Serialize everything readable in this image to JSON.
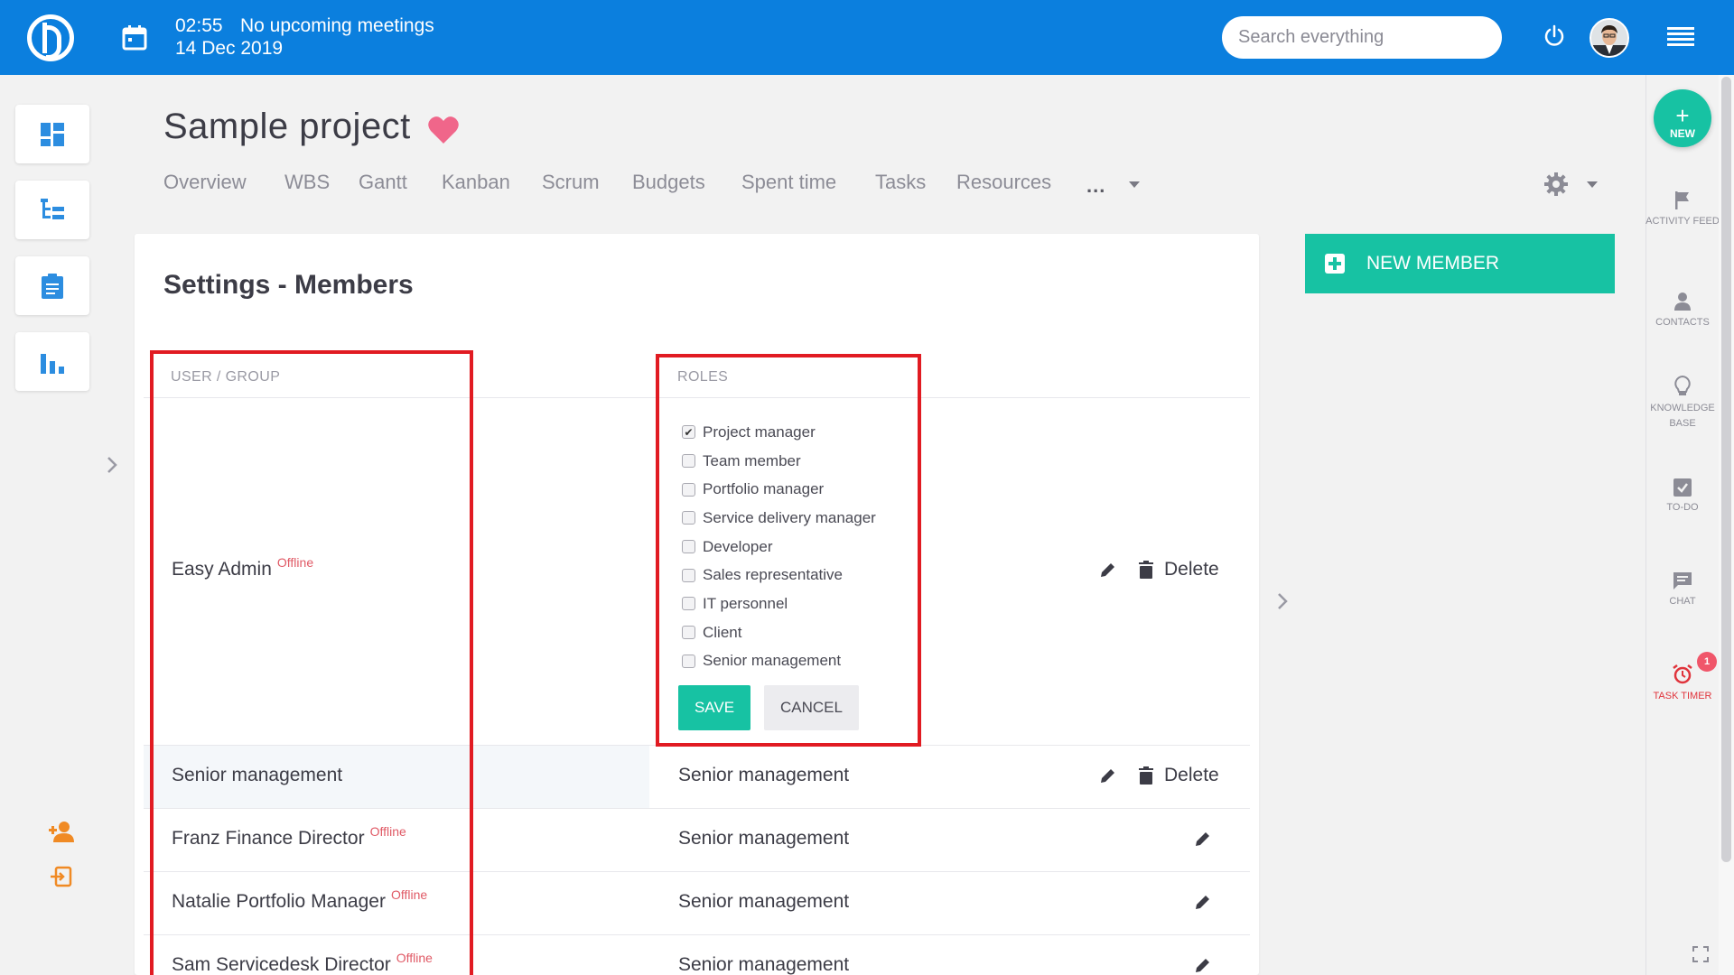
{
  "topbar": {
    "time": "02:55",
    "meetings": "No upcoming meetings",
    "date": "14 Dec 2019",
    "search_placeholder": "Search everything"
  },
  "project": {
    "title": "Sample project",
    "tabs": [
      "Overview",
      "WBS",
      "Gantt",
      "Kanban",
      "Scrum",
      "Budgets",
      "Spent time",
      "Tasks",
      "Resources"
    ],
    "more": "..."
  },
  "card": {
    "title": "Settings - Members",
    "col_user": "USER / GROUP",
    "col_roles": "ROLES"
  },
  "members": [
    {
      "name": "Easy Admin",
      "status": "Offline",
      "roles": "",
      "delete": "Delete"
    },
    {
      "name": "Senior management",
      "status": "",
      "roles": "Senior management",
      "delete": "Delete"
    },
    {
      "name": "Franz Finance Director",
      "status": "Offline",
      "roles": "Senior management",
      "delete": ""
    },
    {
      "name": "Natalie Portfolio Manager",
      "status": "Offline",
      "roles": "Senior management",
      "delete": ""
    },
    {
      "name": "Sam Servicedesk Director",
      "status": "Offline",
      "roles": "Senior management",
      "delete": ""
    }
  ],
  "role_options": [
    {
      "label": "Project manager",
      "checked": true
    },
    {
      "label": "Team member",
      "checked": false
    },
    {
      "label": "Portfolio manager",
      "checked": false
    },
    {
      "label": "Service delivery manager",
      "checked": false
    },
    {
      "label": "Developer",
      "checked": false
    },
    {
      "label": "Sales representative",
      "checked": false
    },
    {
      "label": "IT personnel",
      "checked": false
    },
    {
      "label": "Client",
      "checked": false
    },
    {
      "label": "Senior management",
      "checked": false
    }
  ],
  "buttons": {
    "save": "SAVE",
    "cancel": "CANCEL",
    "new_member": "NEW MEMBER",
    "new": "NEW"
  },
  "rightbar": {
    "activity_feed": "ACTIVITY FEED",
    "contacts": "CONTACTS",
    "knowledge_base": "KNOWLEDGE BASE",
    "todo": "TO-DO",
    "chat": "CHAT",
    "task_timer": "TASK TIMER",
    "timer_badge": "1"
  },
  "colors": {
    "topbar": "#0b7fde",
    "accent": "#17c2a3",
    "offline": "#e05a66",
    "annotation": "#e11b22",
    "heart": "#f0668a"
  }
}
